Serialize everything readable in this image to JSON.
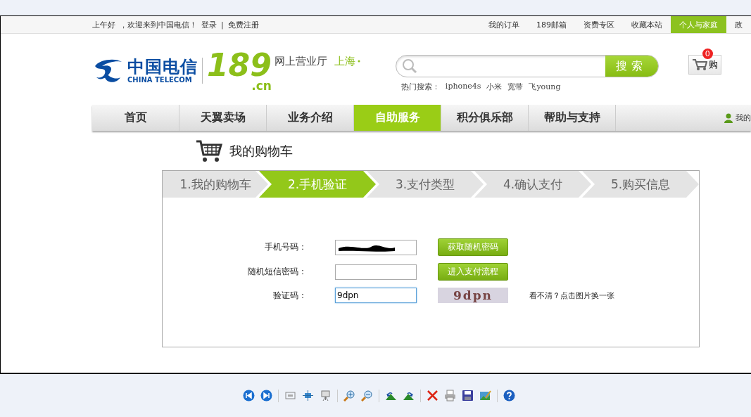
{
  "top_bar": {
    "greeting": "上午好",
    "welcome": "，欢迎来到中国电信！",
    "links": [
      "登录",
      "免费注册"
    ],
    "separator": "|",
    "right_links": [
      {
        "label": "我的订单",
        "selected": false
      },
      {
        "label": "189邮箱",
        "selected": false
      },
      {
        "label": "资费专区",
        "selected": false
      },
      {
        "label": "收藏本站",
        "selected": false
      },
      {
        "label": "个人与家庭",
        "selected": true
      },
      {
        "label": "政",
        "selected": false
      }
    ]
  },
  "header": {
    "logo_cn": "中国电信",
    "logo_en": "CHINA TELECOM",
    "number": "189",
    "domain": ".cn",
    "site_name": "网上营业厅",
    "city": "上海"
  },
  "search": {
    "button": "搜索",
    "hot_label": "热门搜索：",
    "hot_terms": [
      "iphone4s",
      "小米",
      "宽带",
      "飞young"
    ]
  },
  "cart": {
    "count": "0",
    "label": "购"
  },
  "nav": {
    "tabs": [
      {
        "label": "首页",
        "selected": false
      },
      {
        "label": "天翼卖场",
        "selected": false
      },
      {
        "label": "业务介绍",
        "selected": false
      },
      {
        "label": "自助服务",
        "selected": true
      },
      {
        "label": "积分俱乐部",
        "selected": false
      },
      {
        "label": "帮助与支持",
        "selected": false
      }
    ],
    "user_link": "我的"
  },
  "page_title": "我的购物车",
  "steps": [
    {
      "label": "1.我的购物车",
      "selected": false
    },
    {
      "label": "2.手机验证",
      "selected": true
    },
    {
      "label": "3.支付类型",
      "selected": false
    },
    {
      "label": "4.确认支付",
      "selected": false
    },
    {
      "label": "5.购买信息",
      "selected": false
    }
  ],
  "form": {
    "rows": [
      {
        "label": "手机号码：",
        "kind": "redacted",
        "focused": false,
        "button": "获取随机密码"
      },
      {
        "label": "随机短信密码：",
        "kind": "empty",
        "focused": false,
        "button": "进入支付流程"
      },
      {
        "label": "验证码：",
        "kind": "captcha",
        "focused": true,
        "value": "9dpn",
        "captcha_text": "9dpn",
        "hint": "看不清？点击图片换一张"
      }
    ]
  }
}
